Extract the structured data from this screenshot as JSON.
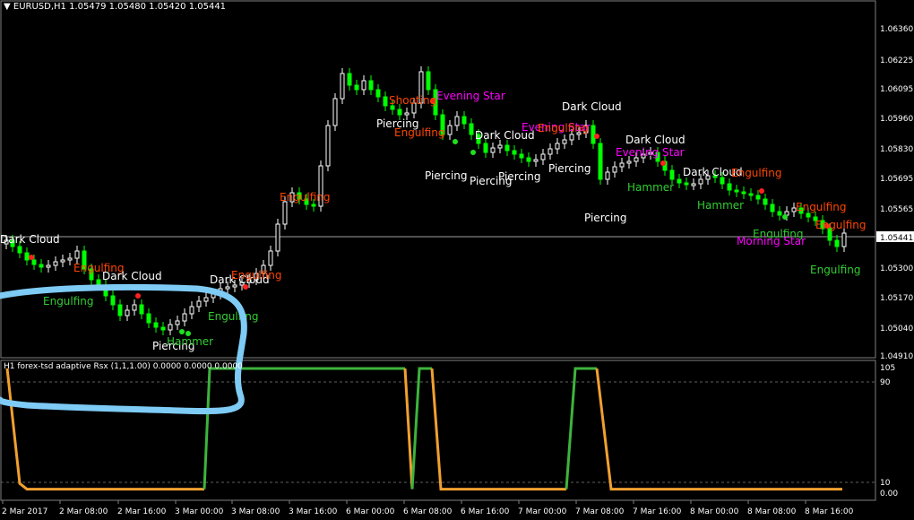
{
  "header": {
    "symbol": "EURUSD,H1",
    "ohlc": "1.05479 1.05480 1.05420 1.05441"
  },
  "indicator": {
    "title": "H1 forex-tsd adaptive Rsx (1,1,1.00) 0.0000 0.0000 0.0000",
    "levels": [
      "105",
      "90",
      "10",
      "0.00",
      "-5"
    ],
    "color_up": "#3cb43c",
    "color_down": "#f0a030"
  },
  "price_axis": [
    "1.06360",
    "1.06225",
    "1.06095",
    "1.05960",
    "1.05830",
    "1.05695",
    "1.05565",
    "1.05300",
    "1.05170",
    "1.05040",
    "1.04910"
  ],
  "current_price": "1.05441",
  "time_axis": [
    "2 Mar 2017",
    "2 Mar 08:00",
    "2 Mar 16:00",
    "3 Mar 00:00",
    "3 Mar 08:00",
    "3 Mar 16:00",
    "6 Mar 00:00",
    "6 Mar 08:00",
    "6 Mar 16:00",
    "7 Mar 00:00",
    "7 Mar 08:00",
    "7 Mar 16:00",
    "8 Mar 00:00",
    "8 Mar 08:00",
    "8 Mar 16:00"
  ],
  "colors": {
    "background": "#000000",
    "bull_candle": "#ffffff",
    "bear_candle": "#00ff00",
    "bullish_label": "#32cd32",
    "bearish_label": "#ff4500",
    "white_label": "#ffffff",
    "magenta_label": "#ff00ff",
    "annotation": "#7ecbf5"
  },
  "patterns": [
    {
      "text": "Dark Cloud",
      "color": "white"
    },
    {
      "text": "Engulfing",
      "color": "red"
    },
    {
      "text": "Dark Cloud",
      "color": "white"
    },
    {
      "text": "Engulfing",
      "color": "green"
    },
    {
      "text": "Piercing",
      "color": "white"
    },
    {
      "text": "Hammer",
      "color": "green"
    },
    {
      "text": "Dark Cloud",
      "color": "white"
    },
    {
      "text": "Engulfing",
      "color": "red"
    },
    {
      "text": "Engulfing",
      "color": "green"
    },
    {
      "text": "Engulfing",
      "color": "red"
    },
    {
      "text": "Shooting",
      "color": "red"
    },
    {
      "text": "Evening Star",
      "color": "magenta"
    },
    {
      "text": "Piercing",
      "color": "white"
    },
    {
      "text": "Engulfing",
      "color": "red"
    },
    {
      "text": "Dark Cloud",
      "color": "white"
    },
    {
      "text": "Piercing",
      "color": "white"
    },
    {
      "text": "Piercing",
      "color": "white"
    },
    {
      "text": "Piercing",
      "color": "white"
    },
    {
      "text": "Evening Star",
      "color": "magenta"
    },
    {
      "text": "Engulfing",
      "color": "red"
    },
    {
      "text": "Dark Cloud",
      "color": "white"
    },
    {
      "text": "Piercing",
      "color": "white"
    },
    {
      "text": "Piercing",
      "color": "white"
    },
    {
      "text": "Dark Cloud",
      "color": "white"
    },
    {
      "text": "Evening Star",
      "color": "magenta"
    },
    {
      "text": "Hammer",
      "color": "green"
    },
    {
      "text": "Dark Cloud",
      "color": "white"
    },
    {
      "text": "Engulfing",
      "color": "red"
    },
    {
      "text": "Hammer",
      "color": "green"
    },
    {
      "text": "Engulfing",
      "color": "green"
    },
    {
      "text": "Morning Star",
      "color": "magenta"
    },
    {
      "text": "Engulfing",
      "color": "red"
    },
    {
      "text": "Engulfing",
      "color": "green"
    },
    {
      "text": "Engulfing",
      "color": "red"
    }
  ]
}
